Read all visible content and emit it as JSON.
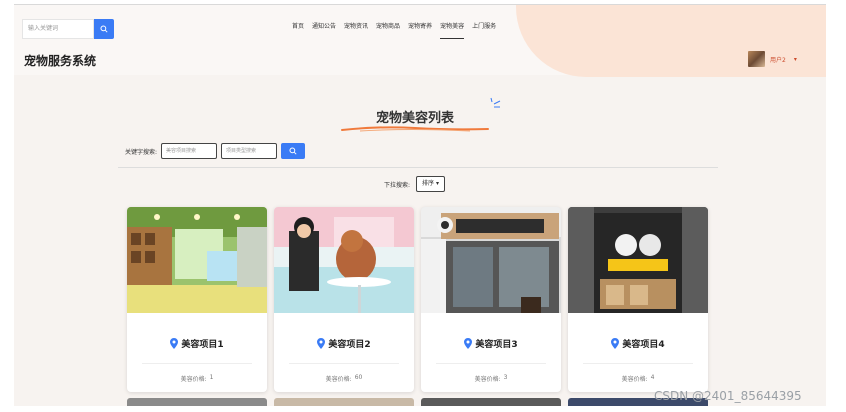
{
  "header": {
    "search_placeholder": "输入关键词",
    "site_title": "宠物服务系统",
    "nav": [
      {
        "label": "首页"
      },
      {
        "label": "通知公告"
      },
      {
        "label": "宠物资讯"
      },
      {
        "label": "宠物商品"
      },
      {
        "label": "宠物寄养"
      },
      {
        "label": "宠物美容",
        "active": true
      },
      {
        "label": "上门服务"
      }
    ],
    "user": {
      "name": "用户2"
    }
  },
  "main": {
    "title": "宠物美容列表",
    "filter": {
      "label": "关键字搜索:",
      "name_placeholder": "美容项目搜索",
      "type_placeholder": "项目类型搜索"
    },
    "sort": {
      "label": "下拉搜索:",
      "button_label": "排序"
    }
  },
  "cards": [
    {
      "name": "美容项目1",
      "price_label": "美容价格:",
      "price": "1"
    },
    {
      "name": "美容项目2",
      "price_label": "美容价格:",
      "price": "60"
    },
    {
      "name": "美容项目3",
      "price_label": "美容价格:",
      "price": "3"
    },
    {
      "name": "美容项目4",
      "price_label": "美容价格:",
      "price": "4"
    }
  ],
  "watermark": "CSDN @2401_85644395",
  "colors": {
    "accent": "#3a7bf5",
    "header_deco": "#fbe4d6",
    "user_text": "#cc4b2c",
    "title_deco": "#f07a3c"
  },
  "icons": {
    "search": "search-icon",
    "location": "location-pin-icon",
    "caret": "caret-down-icon"
  }
}
